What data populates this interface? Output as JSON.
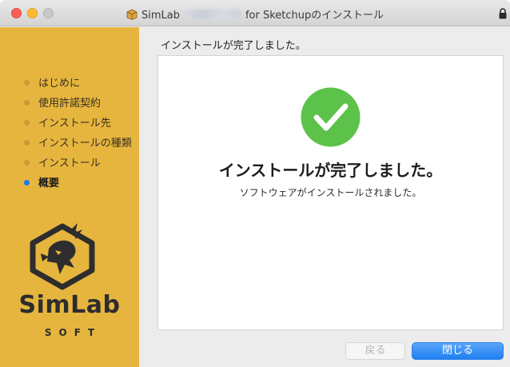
{
  "window": {
    "title_prefix": "SimLab",
    "title_suffix": "for Sketchupのインストール"
  },
  "sidebar": {
    "steps": [
      {
        "label": "はじめに",
        "active": false
      },
      {
        "label": "使用許諾契約",
        "active": false
      },
      {
        "label": "インストール先",
        "active": false
      },
      {
        "label": "インストールの種類",
        "active": false
      },
      {
        "label": "インストール",
        "active": false
      },
      {
        "label": "概要",
        "active": true
      }
    ],
    "brand": "SimLab",
    "brand_sub": "SOFT"
  },
  "main": {
    "heading": "インストールが完了しました。",
    "title": "インストールが完了しました。",
    "subtitle": "ソフトウェアがインストールされました。"
  },
  "buttons": {
    "back": "戻る",
    "close": "閉じる"
  },
  "colors": {
    "sidebar": "#e5b53e",
    "check": "#5cc24a",
    "active_step_dot": "#1a78f0",
    "primary_button": "#1f7ff1"
  }
}
